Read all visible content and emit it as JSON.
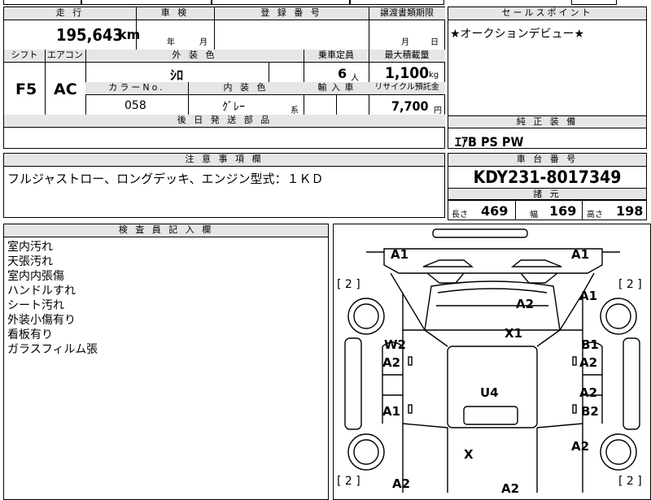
{
  "top": {
    "mileage_header": "走 行",
    "mileage_value": "195,643",
    "mileage_unit": "km",
    "inspection_header": "車 検",
    "inspection_year_label": "年",
    "inspection_month_label": "月",
    "registration_header": "登 録 番 号",
    "transfer_deadline_header": "譲渡書類期限",
    "transfer_month_label": "月",
    "transfer_day_label": "日",
    "shift_header": "シフト",
    "shift_value": "F5",
    "aircon_header": "エアコン",
    "aircon_value": "AC",
    "exterior_color_header": "外 装 色",
    "exterior_color_value": "ｼﾛ",
    "capacity_header": "乗車定員",
    "capacity_value": "6",
    "capacity_unit": "人",
    "max_load_header": "最大積載量",
    "max_load_value": "1,100",
    "max_load_unit": "kg",
    "color_no_header": "カラーNo.",
    "color_no_value": "058",
    "interior_color_header": "内 装 色",
    "interior_color_value": "ｸﾞﾚｰ",
    "interior_color_suffix": "系",
    "import_header": "輸 入 車",
    "recycle_header": "リサイクル預託金",
    "recycle_value": "7,700",
    "recycle_unit": "円",
    "later_parts_header": "後 日 発 送 部 品"
  },
  "sales_point": {
    "header": "セールスポイント",
    "text": "★オークションデビュー★"
  },
  "genuine_equipment": {
    "header": "純 正 装 備",
    "text": "ｴｱB PS PW"
  },
  "notes": {
    "header": "注 意 事 項 欄",
    "text": "フルジャストロー、ロングデッキ、エンジン型式：１ＫＤ"
  },
  "chassis": {
    "header": "車 台 番 号",
    "value": "KDY231-8017349",
    "spec_header": "諸 元",
    "length_label": "長さ",
    "length_value": "469",
    "width_label": "幅",
    "width_value": "169",
    "height_label": "高さ",
    "height_value": "198"
  },
  "inspector": {
    "header": "検 査 員 記 入 欄",
    "lines": [
      "室内汚れ",
      "天張汚れ",
      "室内内張傷",
      "ハンドルすれ",
      "シート汚れ",
      "外装小傷有り",
      "看板有り",
      "ガラスフィルム張"
    ]
  },
  "diagram": {
    "tire_label": "[ 2 ]",
    "codes": {
      "front_left": "A1",
      "front_right": "A1",
      "hood": "A2",
      "front_right_fender": "A1",
      "windshield": "X1",
      "left_front_window": "W2",
      "left_front_door": "A2",
      "right_front_door_top": "B1",
      "right_front_door": "A2",
      "roof": "U4",
      "left_rear_door": "A1",
      "right_rear_door_top": "A2",
      "right_rear_door": "B2",
      "rear_glass": "X",
      "rear_right_fender": "A2",
      "rear_left": "A2",
      "rear_center": "A2"
    }
  }
}
